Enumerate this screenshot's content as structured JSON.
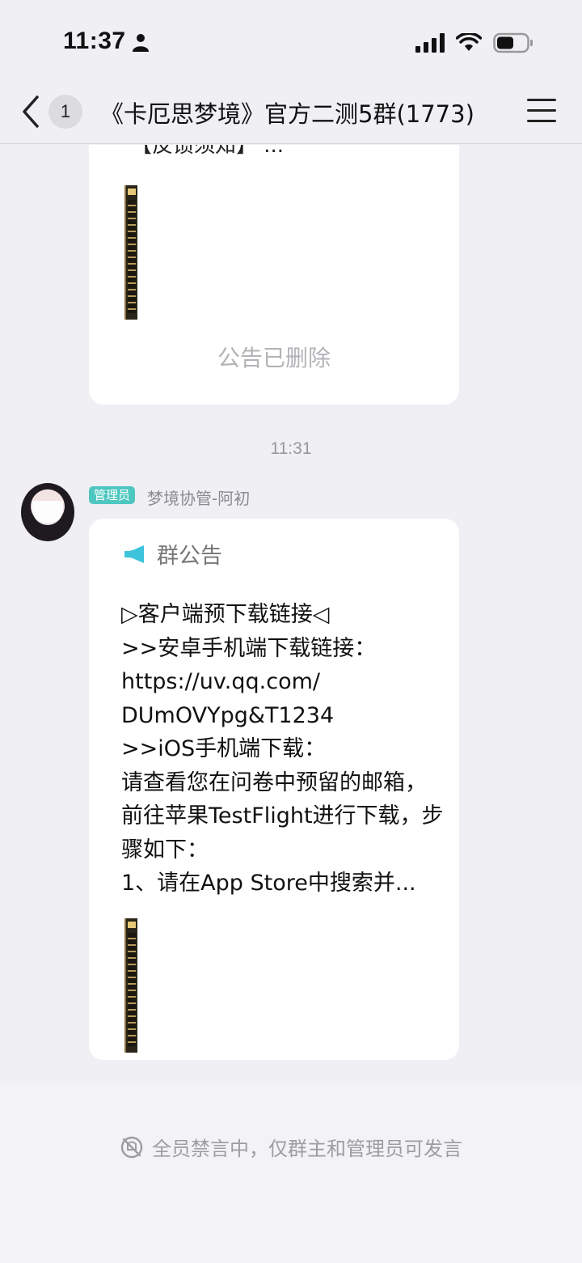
{
  "status_bar": {
    "time": "11:37"
  },
  "nav": {
    "unread_badge": "1",
    "title": "《卡厄思梦境》官方二测5群(1773)"
  },
  "chat": {
    "top_card": {
      "partial_text": "【反馈须知】 ...",
      "deleted_text": "公告已删除"
    },
    "time_divider": "11:31",
    "message": {
      "role_badge": "管理员",
      "sender": "梦境协管-阿初",
      "announcement_label": "群公告",
      "body": "▷客户端预下载链接◁\n>>安卓手机端下载链接：\nhttps://uv.qq.com/\nDUmOVYpg&T1234\n>>iOS手机端下载：\n请查看您在问卷中预留的邮箱，前往苹果TestFlight进行下载，步骤如下：\n1、请在App Store中搜索并..."
    }
  },
  "bottom": {
    "mute_notice": "全员禁言中，仅群主和管理员可发言"
  },
  "colors": {
    "accent_badge": "#4fc7c1",
    "announcement_icon": "#3ec3dc"
  }
}
